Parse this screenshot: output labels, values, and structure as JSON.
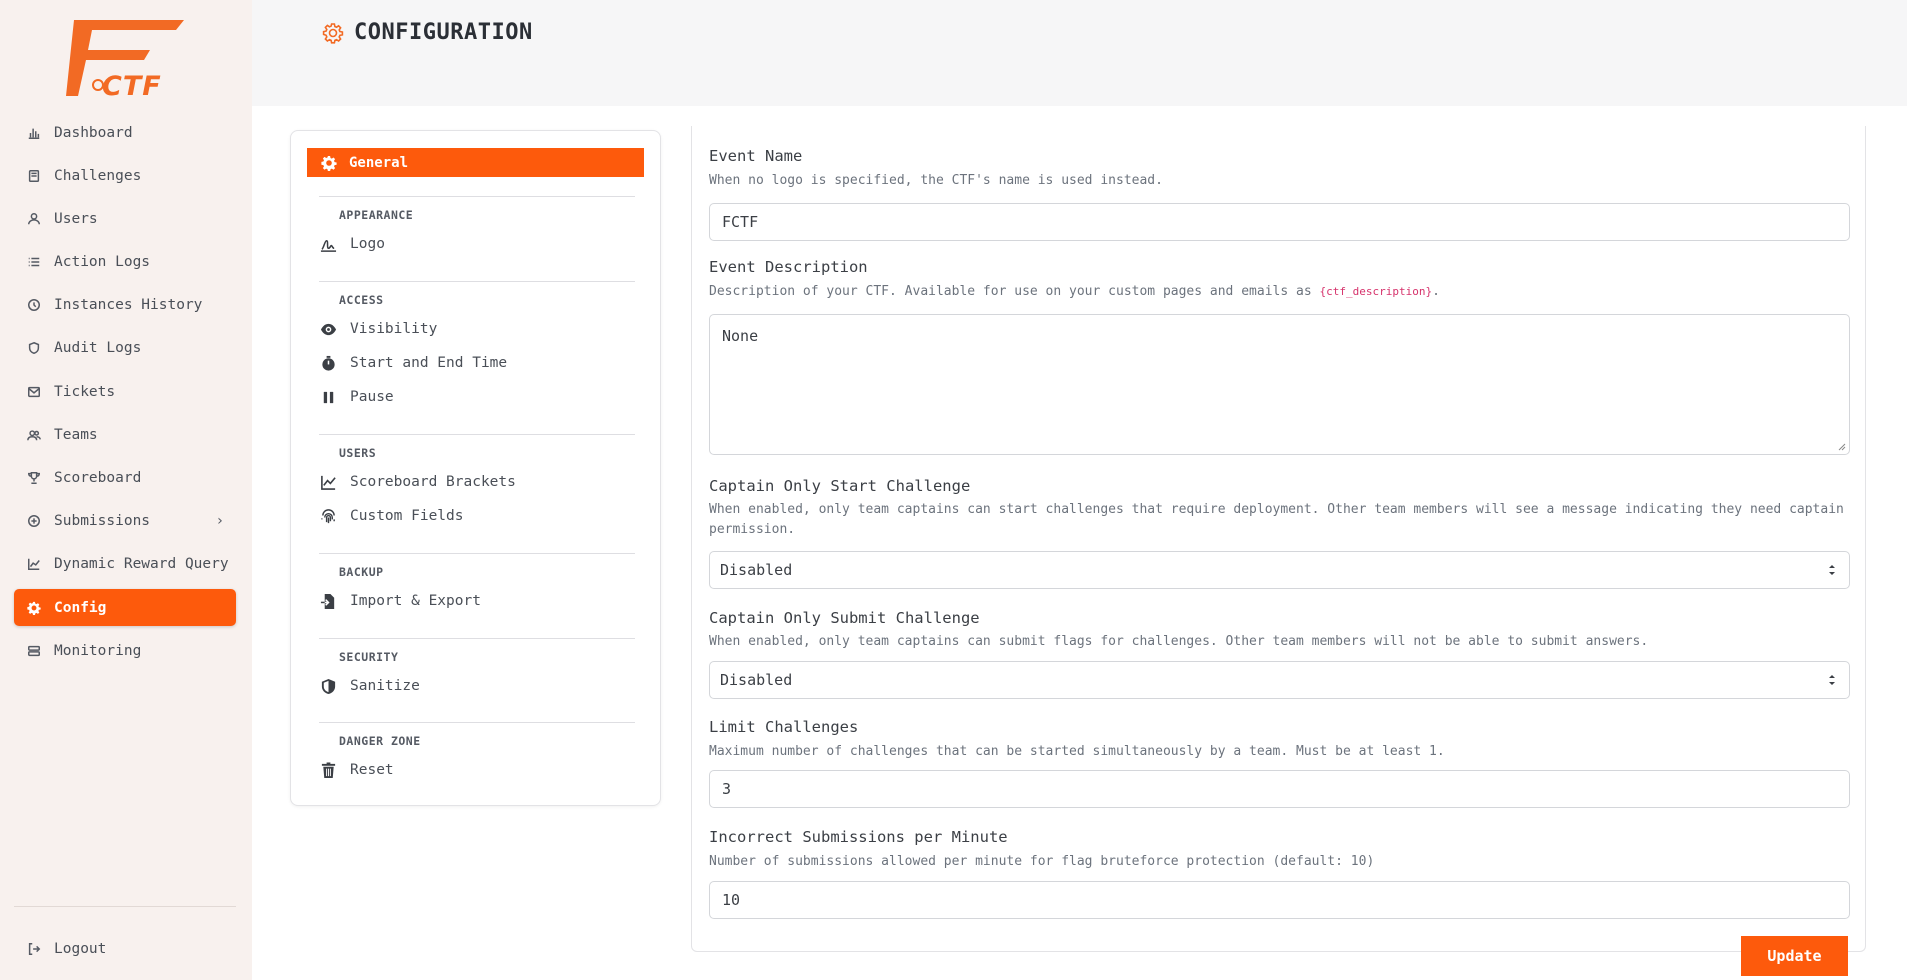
{
  "app": {
    "logo_text": "FCTF",
    "page_title": "CONFIGURATION"
  },
  "sidebar": {
    "items": [
      {
        "label": "Dashboard",
        "icon": "chart-bar-icon"
      },
      {
        "label": "Challenges",
        "icon": "book-icon"
      },
      {
        "label": "Users",
        "icon": "user-icon"
      },
      {
        "label": "Action Logs",
        "icon": "list-icon"
      },
      {
        "label": "Instances History",
        "icon": "history-icon"
      },
      {
        "label": "Audit Logs",
        "icon": "shield-icon"
      },
      {
        "label": "Tickets",
        "icon": "mail-icon"
      },
      {
        "label": "Teams",
        "icon": "users-icon"
      },
      {
        "label": "Scoreboard",
        "icon": "trophy-icon"
      },
      {
        "label": "Submissions",
        "icon": "plus-circle-icon"
      },
      {
        "label": "Dynamic Reward Query",
        "icon": "line-chart-icon"
      },
      {
        "label": "Config",
        "icon": "gear-icon",
        "active": true
      },
      {
        "label": "Monitoring",
        "icon": "server-icon"
      }
    ],
    "submissions_chevron": "›",
    "logout_label": "Logout"
  },
  "settings_menu": {
    "general_label": "General",
    "categories": {
      "appearance": "APPEARANCE",
      "access": "ACCESS",
      "users": "USERS",
      "backup": "BACKUP",
      "security": "SECURITY",
      "danger_zone": "DANGER ZONE"
    },
    "items": {
      "logo": "Logo",
      "visibility": "Visibility",
      "start_end_time": "Start and End Time",
      "pause": "Pause",
      "scoreboard_brackets": "Scoreboard Brackets",
      "custom_fields": "Custom Fields",
      "import_export": "Import & Export",
      "sanitize": "Sanitize",
      "reset": "Reset"
    }
  },
  "form": {
    "event_name": {
      "label": "Event Name",
      "help": "When no logo is specified, the CTF's name is used instead.",
      "value": "FCTF"
    },
    "event_description": {
      "label": "Event Description",
      "help": "Description of your CTF. Available for use on your custom pages and emails as",
      "help_code": "{ctf_description}",
      "help_suffix": ".",
      "value": "None"
    },
    "captain_only_start": {
      "label": "Captain Only Start Challenge",
      "help": "When enabled, only team captains can start challenges that require deployment. Other team members will see a message indicating they need captain permission.",
      "value": "Disabled"
    },
    "captain_only_submit": {
      "label": "Captain Only Submit Challenge",
      "help": "When enabled, only team captains can submit flags for challenges. Other team members will not be able to submit answers.",
      "value": "Disabled"
    },
    "limit_challenges": {
      "label": "Limit Challenges",
      "help": "Maximum number of challenges that can be started simultaneously by a team. Must be at least 1.",
      "value": "3"
    },
    "incorrect_submissions": {
      "label": "Incorrect Submissions per Minute",
      "help": "Number of submissions allowed per minute for flag bruteforce protection (default: 10)",
      "value": "10"
    },
    "update_label": "Update"
  },
  "colors": {
    "accent": "#fd5a0c",
    "sidebar_bg": "#f8f1ee",
    "header_bg": "#f6f6f7"
  }
}
